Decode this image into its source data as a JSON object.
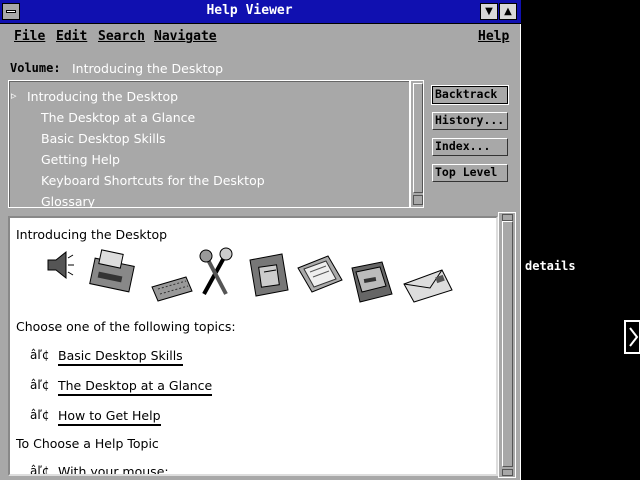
{
  "window": {
    "title": "Help Viewer",
    "minimize_glyph": "▼",
    "maximize_glyph": "▲"
  },
  "menubar": {
    "file": "File",
    "edit": "Edit",
    "search": "Search",
    "navigate": "Navigate",
    "help": "Help"
  },
  "volume": {
    "label": "Volume:",
    "value": "Introducing the Desktop"
  },
  "topics": {
    "marker": "▹",
    "items": [
      "Introducing the Desktop",
      "The Desktop at a Glance",
      "Basic Desktop Skills",
      "Getting Help",
      "Keyboard Shortcuts for the Desktop",
      "Glossary"
    ]
  },
  "buttons": {
    "backtrack": "Backtrack",
    "history": "History...",
    "index": "Index...",
    "top_level": "Top Level"
  },
  "content": {
    "heading": "Introducing the Desktop",
    "choose_text": "Choose one of the following topics:",
    "bullet": "âľ¢",
    "links": [
      "Basic Desktop Skills",
      "The Desktop at a Glance",
      "How to Get Help"
    ],
    "subheading": "To Choose a Help Topic",
    "last_item": "With your mouse:",
    "pictures": [
      "speaker-icon",
      "printer-icon",
      "keyboard-icon",
      "tools-icon",
      "file-cabinet-icon",
      "screen-icon",
      "mailbox-icon",
      "envelope-icon"
    ]
  },
  "side": {
    "details_label": "details"
  }
}
